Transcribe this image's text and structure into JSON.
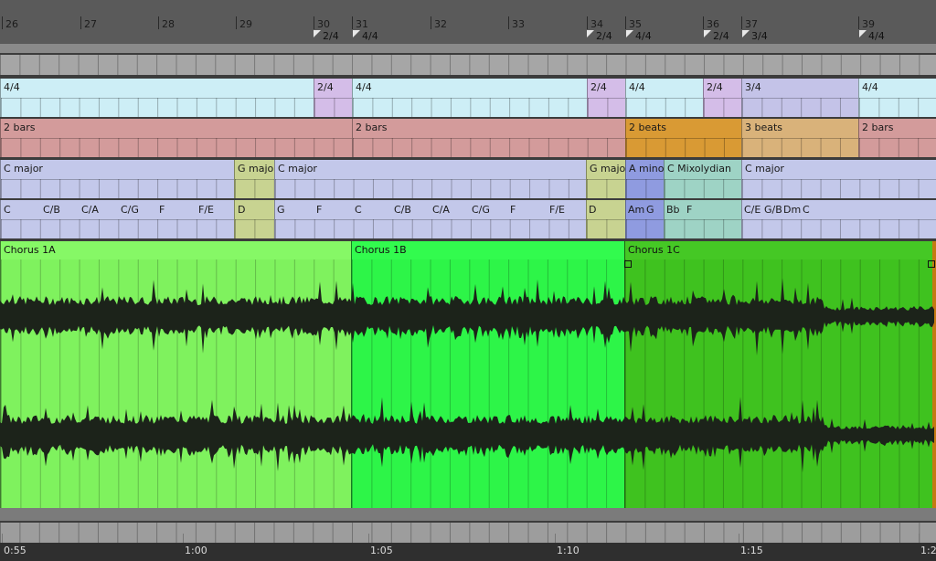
{
  "ruler": {
    "bars": [
      "26",
      "27",
      "28",
      "29",
      "30",
      "31",
      "32",
      "33",
      "34",
      "35",
      "36",
      "37",
      "39"
    ],
    "signature_markers": [
      "2/4",
      "4/4",
      "2/4",
      "4/4",
      "2/4",
      "3/4",
      "4/4"
    ]
  },
  "time_signature_lane": {
    "segments": [
      "4/4",
      "2/4",
      "4/4",
      "2/4",
      "4/4",
      "2/4",
      "3/4",
      "4/4"
    ]
  },
  "tempo_lane": {
    "segments": [
      "2 bars",
      "2 bars",
      "2 beats",
      "3 beats",
      "2 bars"
    ]
  },
  "scale_lane": {
    "segments": [
      "C major",
      "G majo",
      "C major",
      "G majo",
      "A mino",
      "C Mixolydian",
      "C major"
    ]
  },
  "chord_lane": {
    "chords": [
      "C",
      "C/B",
      "C/A",
      "C/G",
      "F",
      "F/E",
      "D",
      "G",
      "F",
      "C",
      "C/B",
      "C/A",
      "C/G",
      "F",
      "F/E",
      "D",
      "Am",
      "G",
      "Bb",
      "F",
      "C/E",
      "G/B",
      "Dm",
      "C"
    ]
  },
  "clips": [
    {
      "name": "Chorus 1A",
      "color": "#7ff25e"
    },
    {
      "name": "Chorus 1B",
      "color": "#2df548"
    },
    {
      "name": "Chorus 1C",
      "color": "#3fc21f"
    }
  ],
  "time_ruler": {
    "labels": [
      "0:55",
      "1:00",
      "1:05",
      "1:10",
      "1:15",
      "1:2"
    ]
  },
  "colors": {
    "ts_lane": "#cdeef6",
    "ts_alt": "#d4bde8",
    "ts_34": "#c4c3e8",
    "tempo": "#d39b9b",
    "tempo_orange": "#d99a34",
    "tempo_tan": "#d9b27a",
    "scale": "#c3c8ea",
    "scale_yellow": "#c8d391",
    "scale_blue": "#8f9be0",
    "scale_teal": "#9ed3c5"
  }
}
